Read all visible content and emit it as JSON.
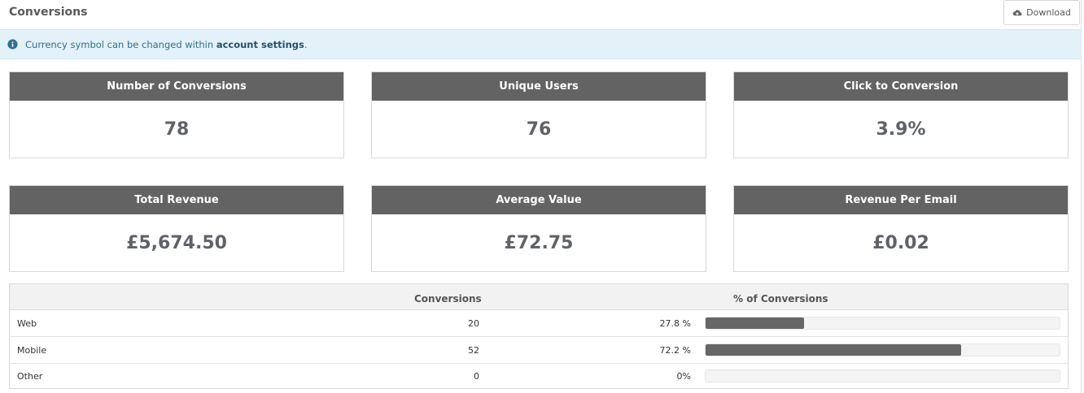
{
  "header": {
    "title": "Conversions",
    "download_label": "Download"
  },
  "info": {
    "prefix": "Currency symbol can be changed within ",
    "link": "account settings",
    "suffix": "."
  },
  "stats": [
    {
      "label": "Number of Conversions",
      "value": "78"
    },
    {
      "label": "Unique Users",
      "value": "76"
    },
    {
      "label": "Click to Conversion",
      "value": "3.9%"
    },
    {
      "label": "Total Revenue",
      "value": "£5,674.50"
    },
    {
      "label": "Average Value",
      "value": "£72.75"
    },
    {
      "label": "Revenue Per Email",
      "value": "£0.02"
    }
  ],
  "table": {
    "columns": [
      "",
      "Conversions",
      "% of Conversions"
    ],
    "rows": [
      {
        "name": "Web",
        "conversions": "20",
        "percent_label": "27.8 %",
        "percent": 27.8
      },
      {
        "name": "Mobile",
        "conversions": "52",
        "percent_label": "72.2 %",
        "percent": 72.2
      },
      {
        "name": "Other",
        "conversions": "0",
        "percent_label": "0%",
        "percent": 0
      }
    ]
  },
  "colors": {
    "card_header": "#636363",
    "info_background": "#e3f1f8",
    "bar_fill": "#666666"
  }
}
